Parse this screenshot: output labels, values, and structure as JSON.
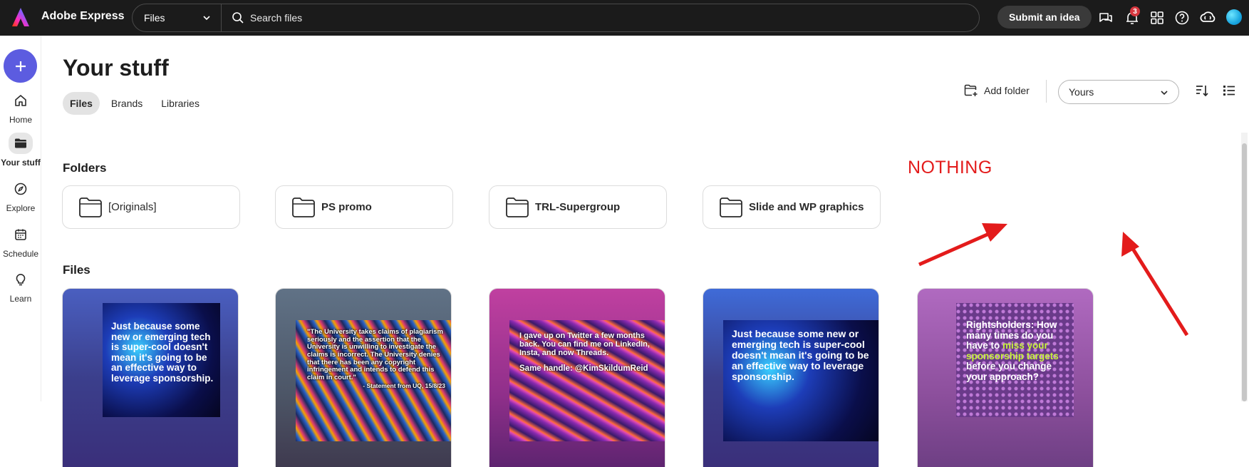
{
  "topbar": {
    "app_name": "Adobe Express",
    "search_scope": "Files",
    "search_placeholder": "Search files",
    "submit_idea_label": "Submit an idea",
    "notification_count": "3",
    "icons": [
      "chat-icon",
      "bell-icon",
      "apps-icon",
      "help-icon",
      "creative-cloud-icon",
      "avatar"
    ]
  },
  "sidebar": {
    "create_label": "+",
    "items": [
      {
        "label": "Home",
        "icon": "home-icon"
      },
      {
        "label": "Your stuff",
        "icon": "folder-icon",
        "active": true
      },
      {
        "label": "Explore",
        "icon": "compass-icon"
      },
      {
        "label": "Schedule",
        "icon": "calendar-icon"
      },
      {
        "label": "Learn",
        "icon": "lightbulb-icon"
      }
    ]
  },
  "main": {
    "title": "Your stuff",
    "tabs": [
      {
        "label": "Files",
        "active": true
      },
      {
        "label": "Brands"
      },
      {
        "label": "Libraries"
      }
    ],
    "add_folder_label": "Add folder",
    "owner_filter": "Yours",
    "folders_heading": "Folders",
    "folders": [
      {
        "name": "[Originals]"
      },
      {
        "name": "PS promo"
      },
      {
        "name": "TRL-Supergroup"
      },
      {
        "name": "Slide and WP graphics"
      }
    ],
    "files_heading": "Files",
    "files": [
      {
        "text": "Just because some new or emerging tech is super-cool doesn't mean it's going to be an effective way to leverage sponsorship."
      },
      {
        "text": "\"The University takes claims of plagiarism seriously and the assertion that the University is unwilling to investigate the claims is incorrect. The University denies that there has been any copyright infringement and intends to defend this claim in court.\"",
        "caption": "- Statement from UQ, 15/8/23"
      },
      {
        "text": "I gave up on Twitter a few months back. You can find me on LinkedIn, Insta, and now Threads.",
        "handle": "Same handle: @KimSkildumReid"
      },
      {
        "text": "Just because some new or emerging tech is super-cool doesn't mean it's going to be an effective way to leverage sponsorship."
      },
      {
        "text_a": "Rightsholders: How many times do you have to ",
        "text_b": "miss your sponsorship targets",
        "text_c": " before you change your approach?"
      }
    ]
  },
  "annotation": {
    "text": "NOTHING",
    "color": "#e31b1b"
  },
  "colors": {
    "topbar_bg": "#1b1b1b",
    "create_button": "#5c5ce0",
    "badge": "#d7373f",
    "highlight_green": "#c6f23a"
  }
}
